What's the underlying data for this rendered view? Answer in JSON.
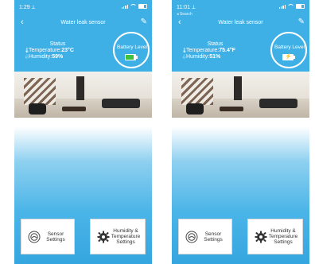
{
  "screens": [
    {
      "status_bar": {
        "time": "1:29 ⟂",
        "sub": ""
      },
      "nav": {
        "back": "‹",
        "title": "Water leak sensor",
        "edit": "✎"
      },
      "status": {
        "title": "Status",
        "temperature_label": "Temperature:",
        "temperature_value": "23°C",
        "humidity_label": "Humidity:",
        "humidity_value": "59%"
      },
      "battery": {
        "label": "Battery Level",
        "state": "green-level",
        "fill_fraction": 0.8
      },
      "buttons": [
        {
          "label_line1": "Sensor",
          "label_line2": "Settings",
          "icon": "sensor-settings-icon"
        },
        {
          "label_line1": "Humidity &",
          "label_line2": "Temperature",
          "label_line3": "Settings",
          "icon": "gear-icon"
        }
      ]
    },
    {
      "status_bar": {
        "time": "11:01 ⟂",
        "sub": "◂ Search"
      },
      "nav": {
        "back": "‹",
        "title": "Water leak sensor",
        "edit": "✎"
      },
      "status": {
        "title": "Status",
        "temperature_label": "Temperature:",
        "temperature_value": "75.4°F",
        "humidity_label": "Humidity:",
        "humidity_value": "51%"
      },
      "battery": {
        "label": "Battery Level",
        "state": "charging",
        "fill_fraction": 0.0
      },
      "buttons": [
        {
          "label_line1": "Sensor",
          "label_line2": "Settings",
          "icon": "sensor-settings-icon"
        },
        {
          "label_line1": "Humidity &",
          "label_line2": "Temperature",
          "label_line3": "Settings",
          "icon": "gear-icon"
        }
      ]
    }
  ],
  "colors": {
    "header": "#3fb0e6",
    "battery_green": "#3fc13f",
    "charging_bolt": "#e8c000"
  }
}
